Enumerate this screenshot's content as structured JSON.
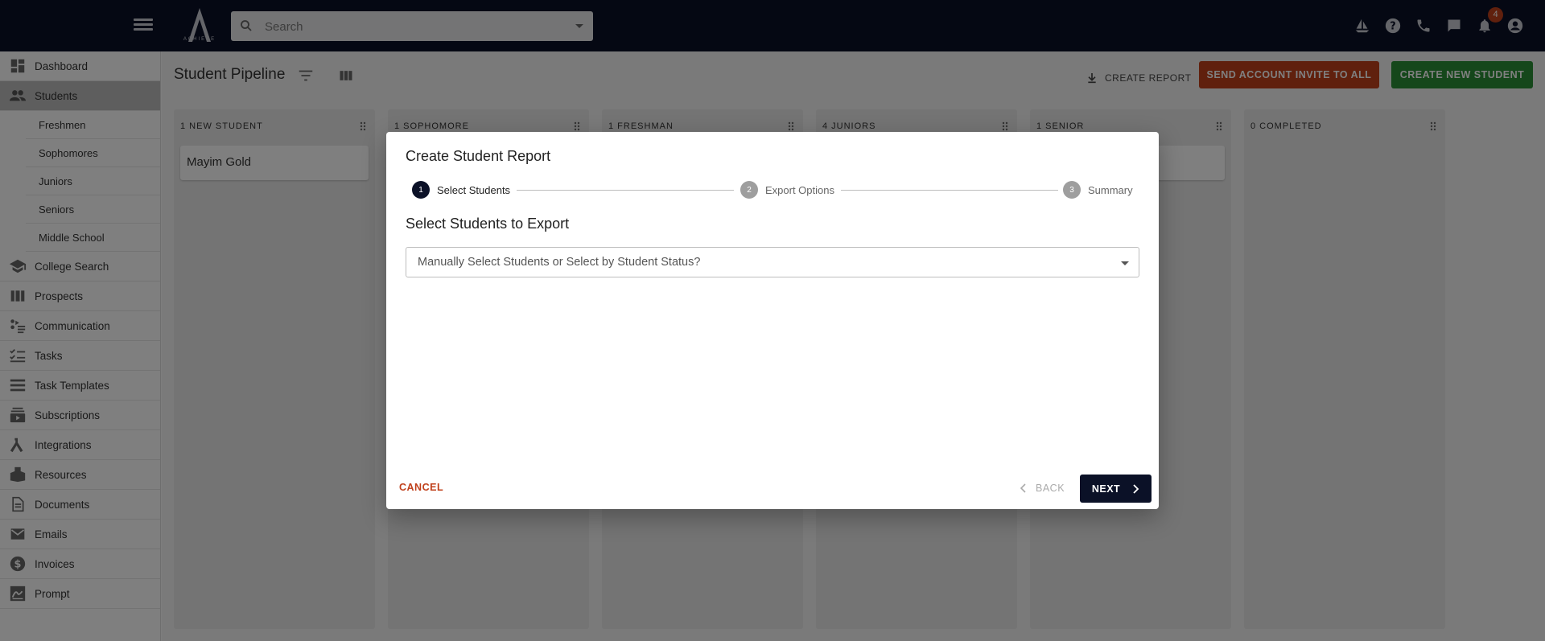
{
  "topbar": {
    "search_placeholder": "Search",
    "logo_text": "ACHIEVE",
    "notification_count": "4"
  },
  "sidebar": {
    "items": [
      {
        "label": "Dashboard",
        "icon": "dashboard-icon"
      },
      {
        "label": "Students",
        "icon": "people-icon",
        "active": true
      },
      {
        "label": "College Search",
        "icon": "school-icon"
      },
      {
        "label": "Prospects",
        "icon": "columns-icon"
      },
      {
        "label": "Communication",
        "icon": "communication-icon"
      },
      {
        "label": "Tasks",
        "icon": "checklist-icon"
      },
      {
        "label": "Task Templates",
        "icon": "list-icon"
      },
      {
        "label": "Subscriptions",
        "icon": "subscriptions-icon"
      },
      {
        "label": "Integrations",
        "icon": "merge-icon"
      },
      {
        "label": "Resources",
        "icon": "resources-icon"
      },
      {
        "label": "Documents",
        "icon": "document-icon"
      },
      {
        "label": "Emails",
        "icon": "email-icon"
      },
      {
        "label": "Invoices",
        "icon": "dollar-icon"
      },
      {
        "label": "Prompt",
        "icon": "signature-icon"
      }
    ],
    "sub_items": [
      "Freshmen",
      "Sophomores",
      "Juniors",
      "Seniors",
      "Middle School"
    ]
  },
  "main": {
    "title": "Student Pipeline",
    "create_report": "CREATE REPORT",
    "invite_all": "SEND ACCOUNT INVITE TO ALL",
    "create_student": "CREATE NEW STUDENT",
    "columns": [
      {
        "header": "1 NEW STUDENT",
        "card": "Mayim Gold"
      },
      {
        "header": "1 SOPHOMORE"
      },
      {
        "header": "1 FRESHMAN"
      },
      {
        "header": "4 JUNIORS"
      },
      {
        "header": "1 SENIOR"
      },
      {
        "header": "0 COMPLETED"
      }
    ]
  },
  "dialog": {
    "title": "Create Student Report",
    "steps": [
      {
        "number": "1",
        "label": "Select Students"
      },
      {
        "number": "2",
        "label": "Export Options"
      },
      {
        "number": "3",
        "label": "Summary"
      }
    ],
    "section_title": "Select Students to Export",
    "select_value": "Manually Select Students or Select by Student Status?",
    "cancel": "CANCEL",
    "back": "BACK",
    "next": "NEXT"
  },
  "colors": {
    "navy": "#0b1127",
    "orange": "#c0401b",
    "green": "#2b8f36"
  }
}
